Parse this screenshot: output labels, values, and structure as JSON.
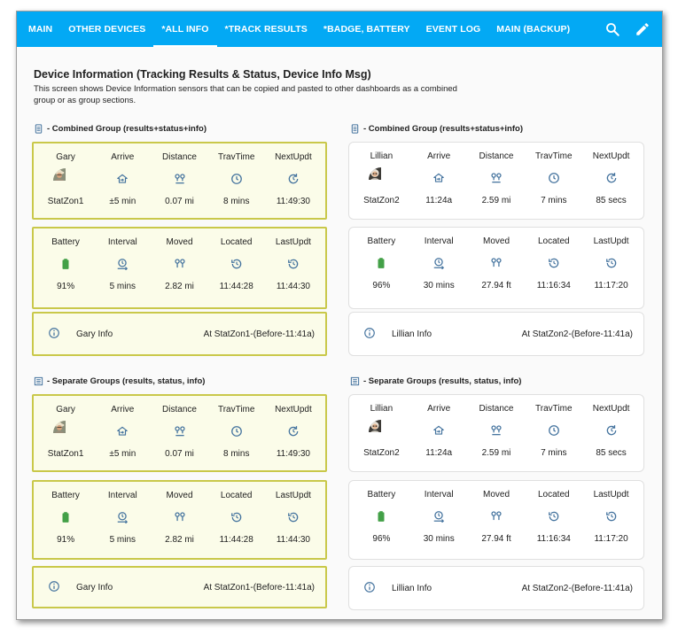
{
  "tabs": [
    {
      "label": "MAIN",
      "active": false
    },
    {
      "label": "OTHER DEVICES",
      "active": false
    },
    {
      "label": "*ALL INFO",
      "active": true
    },
    {
      "label": "*TRACK RESULTS",
      "active": false
    },
    {
      "label": "*BADGE, BATTERY",
      "active": false
    },
    {
      "label": "EVENT LOG",
      "active": false
    },
    {
      "label": "MAIN (BACKUP)",
      "active": false
    }
  ],
  "toolbar_icons": [
    "search-icon",
    "pencil-icon"
  ],
  "intro": {
    "title": "Device Information (Tracking Results & Status, Device Info Msg)",
    "description": "This screen shows Device Information sensors that can be copied and pasted to other dashboards as a combined group or as group sections."
  },
  "sections": {
    "combined_title": "- Combined Group (results+status+info)",
    "separate_title": "- Separate Groups (results, status, info)"
  },
  "colors": {
    "accent": "#03a9f4",
    "icon_blue": "#44739e",
    "battery_green": "#43a047",
    "highlight_border": "#c9c84a",
    "highlight_bg": "#fbfce9"
  },
  "gary": {
    "results": {
      "labels": [
        "Gary",
        "Arrive",
        "Distance",
        "TravTime",
        "NextUpdt"
      ],
      "values": [
        "StatZon1",
        "±5 min",
        "0.07 mi",
        "8 mins",
        "11:49:30"
      ]
    },
    "status": {
      "labels": [
        "Battery",
        "Interval",
        "Moved",
        "Located",
        "LastUpdt"
      ],
      "values": [
        "91%",
        "5 mins",
        "2.82 mi",
        "11:44:28",
        "11:44:30"
      ]
    },
    "info": {
      "name": "Gary Info",
      "state": "At StatZon1-(Before-11:41a)"
    }
  },
  "lillian": {
    "results": {
      "labels": [
        "Lillian",
        "Arrive",
        "Distance",
        "TravTime",
        "NextUpdt"
      ],
      "values": [
        "StatZon2",
        "11:24a",
        "2.59 mi",
        "7 mins",
        "85 secs"
      ]
    },
    "status": {
      "labels": [
        "Battery",
        "Interval",
        "Moved",
        "Located",
        "LastUpdt"
      ],
      "values": [
        "96%",
        "30 mins",
        "27.94 ft",
        "11:16:34",
        "11:17:20"
      ]
    },
    "info": {
      "name": "Lillian Info",
      "state": "At StatZon2-(Before-11:41a)"
    }
  }
}
